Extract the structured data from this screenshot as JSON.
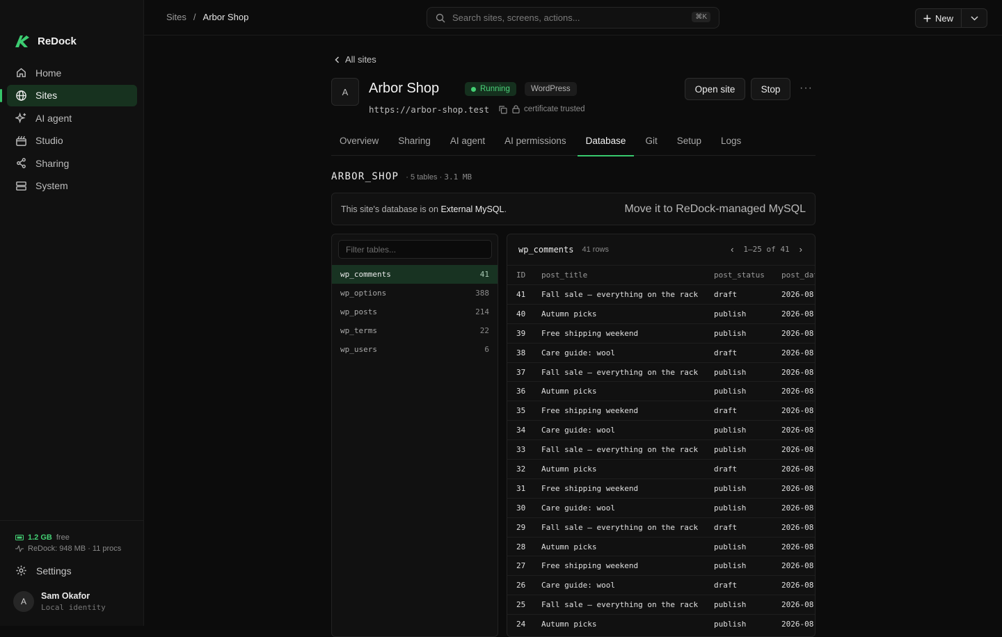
{
  "brand": {
    "name": "ReDock",
    "accent": "#36c66a"
  },
  "sidebar": {
    "items": [
      {
        "label": "Home",
        "icon": "home-icon"
      },
      {
        "label": "Sites",
        "icon": "globe-icon",
        "active": true
      },
      {
        "label": "AI agent",
        "icon": "sparkle-icon"
      },
      {
        "label": "Studio",
        "icon": "studio-icon"
      },
      {
        "label": "Sharing",
        "icon": "share-icon"
      },
      {
        "label": "System",
        "icon": "server-icon"
      }
    ],
    "memory": {
      "free_value": "1.2 GB",
      "free_label": "free",
      "usage": "ReDock: 948 MB · 11 procs"
    },
    "settings_label": "Settings",
    "user": {
      "initial": "A",
      "name": "Sam Okafor",
      "subtitle": "Local identity"
    }
  },
  "topbar": {
    "breadcrumb_root": "Sites",
    "breadcrumb_sep": "/",
    "breadcrumb_current": "Arbor Shop",
    "search_placeholder": "Search sites, screens, actions...",
    "search_shortcut": "⌘K",
    "new_label": "New"
  },
  "site": {
    "back_label": "All sites",
    "initial": "A",
    "title": "Arbor Shop",
    "status": "Running",
    "platform": "WordPress",
    "url": "https://arbor-shop.test",
    "cert": "certificate trusted",
    "open_label": "Open site",
    "stop_label": "Stop",
    "more_label": "···"
  },
  "tabs": [
    "Overview",
    "Sharing",
    "AI agent",
    "AI permissions",
    "Database",
    "Git",
    "Setup",
    "Logs"
  ],
  "active_tab": "Database",
  "database": {
    "name": "ARBOR_SHOP",
    "meta_prefix": "· 5 tables ·",
    "meta_size": "3.1 MB",
    "notice_prefix": "This site's database is on",
    "notice_engine": "External MySQL",
    "notice_suffix": ".",
    "migrate_label": "Move it to ReDock-managed MySQL",
    "filter_placeholder": "Filter tables...",
    "tables": [
      {
        "name": "wp_comments",
        "count": "41",
        "active": true
      },
      {
        "name": "wp_options",
        "count": "388"
      },
      {
        "name": "wp_posts",
        "count": "214"
      },
      {
        "name": "wp_terms",
        "count": "22"
      },
      {
        "name": "wp_users",
        "count": "6"
      }
    ],
    "current_table": "wp_comments",
    "row_count": "41 rows",
    "pager": "1–25 of 41",
    "columns": [
      "ID",
      "post_title",
      "post_status",
      "post_date"
    ],
    "rows": [
      [
        "41",
        "Fall sale — everything on the rack",
        "draft",
        "2026-08"
      ],
      [
        "40",
        "Autumn picks",
        "publish",
        "2026-08"
      ],
      [
        "39",
        "Free shipping weekend",
        "publish",
        "2026-08"
      ],
      [
        "38",
        "Care guide: wool",
        "draft",
        "2026-08"
      ],
      [
        "37",
        "Fall sale — everything on the rack",
        "publish",
        "2026-08"
      ],
      [
        "36",
        "Autumn picks",
        "publish",
        "2026-08"
      ],
      [
        "35",
        "Free shipping weekend",
        "draft",
        "2026-08"
      ],
      [
        "34",
        "Care guide: wool",
        "publish",
        "2026-08"
      ],
      [
        "33",
        "Fall sale — everything on the rack",
        "publish",
        "2026-08"
      ],
      [
        "32",
        "Autumn picks",
        "draft",
        "2026-08"
      ],
      [
        "31",
        "Free shipping weekend",
        "publish",
        "2026-08"
      ],
      [
        "30",
        "Care guide: wool",
        "publish",
        "2026-08"
      ],
      [
        "29",
        "Fall sale — everything on the rack",
        "draft",
        "2026-08"
      ],
      [
        "28",
        "Autumn picks",
        "publish",
        "2026-08"
      ],
      [
        "27",
        "Free shipping weekend",
        "publish",
        "2026-08"
      ],
      [
        "26",
        "Care guide: wool",
        "draft",
        "2026-08"
      ],
      [
        "25",
        "Fall sale — everything on the rack",
        "publish",
        "2026-08"
      ],
      [
        "24",
        "Autumn picks",
        "publish",
        "2026-08"
      ]
    ]
  }
}
